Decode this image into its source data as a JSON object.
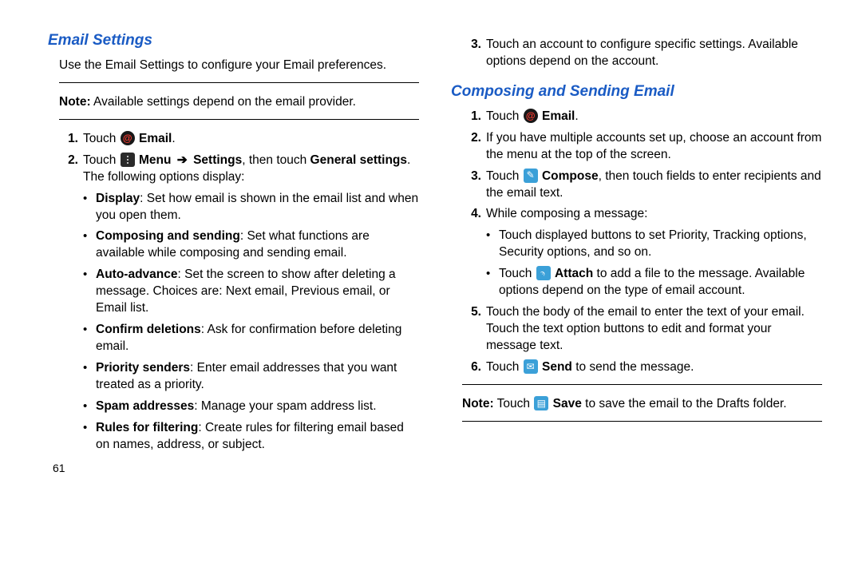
{
  "page_number": "61",
  "left": {
    "title": "Email Settings",
    "intro": "Use the Email Settings to configure your Email preferences.",
    "note_label": "Note:",
    "note_text": " Available settings depend on the email provider.",
    "steps": [
      {
        "num": "1.",
        "parts": [
          {
            "t": "Touch "
          },
          {
            "icon": "email"
          },
          {
            "t": " "
          },
          {
            "b": "Email"
          },
          {
            "t": "."
          }
        ]
      },
      {
        "num": "2.",
        "parts": [
          {
            "t": "Touch "
          },
          {
            "icon": "menu"
          },
          {
            "t": " "
          },
          {
            "b": "Menu"
          },
          {
            "t": " "
          },
          {
            "arrow": "➔"
          },
          {
            "t": " "
          },
          {
            "b": "Settings"
          },
          {
            "t": ", then touch "
          },
          {
            "b": "General settings"
          },
          {
            "t": ". The following options display:"
          }
        ],
        "bullets": [
          {
            "head": "Display",
            "text": ": Set how email is shown in the email list and when you open them."
          },
          {
            "head": "Composing and sending",
            "text": ": Set what functions are available while composing and sending email."
          },
          {
            "head": "Auto-advance",
            "text": ": Set the screen to show after deleting a message. Choices are: Next email, Previous email, or Email list."
          },
          {
            "head": "Confirm deletions",
            "text": ": Ask for confirmation before deleting email."
          },
          {
            "head": "Priority senders",
            "text": ": Enter email addresses that you want treated as a priority."
          },
          {
            "head": "Spam addresses",
            "text": ": Manage your spam address list."
          },
          {
            "head": "Rules for filtering",
            "text": ": Create rules for filtering email based on names, address, or subject."
          }
        ]
      }
    ]
  },
  "right": {
    "step3": {
      "num": "3.",
      "text": "Touch an account to configure specific settings. Available options depend on the account."
    },
    "title": "Composing and Sending Email",
    "steps": [
      {
        "num": "1.",
        "parts": [
          {
            "t": "Touch "
          },
          {
            "icon": "email"
          },
          {
            "t": " "
          },
          {
            "b": "Email"
          },
          {
            "t": "."
          }
        ]
      },
      {
        "num": "2.",
        "parts": [
          {
            "t": "If you have multiple accounts set up, choose an account from the menu at the top of the screen."
          }
        ]
      },
      {
        "num": "3.",
        "parts": [
          {
            "t": "Touch "
          },
          {
            "icon": "compose"
          },
          {
            "t": " "
          },
          {
            "b": "Compose"
          },
          {
            "t": ", then touch fields to enter recipients and the email text."
          }
        ]
      },
      {
        "num": "4.",
        "parts": [
          {
            "t": "While composing a message:"
          }
        ],
        "bullets": [
          {
            "text_plain": "Touch displayed buttons to set Priority, Tracking options, Security options, and so on."
          },
          {
            "parts": [
              {
                "t": "Touch "
              },
              {
                "icon": "attach"
              },
              {
                "t": " "
              },
              {
                "b": "Attach"
              },
              {
                "t": " to add a file to the message. Available options depend on the type of email account."
              }
            ]
          }
        ]
      },
      {
        "num": "5.",
        "parts": [
          {
            "t": "Touch the body of the email to enter the text of your email. Touch the text option buttons to edit and format your message text."
          }
        ]
      },
      {
        "num": "6.",
        "parts": [
          {
            "t": "Touch "
          },
          {
            "icon": "send"
          },
          {
            "t": " "
          },
          {
            "b": "Send"
          },
          {
            "t": " to send the message."
          }
        ]
      }
    ],
    "note_label": "Note:",
    "note_parts": [
      {
        "t": " Touch "
      },
      {
        "icon": "save"
      },
      {
        "t": " "
      },
      {
        "b": "Save"
      },
      {
        "t": " to save the email to the Drafts folder."
      }
    ]
  }
}
